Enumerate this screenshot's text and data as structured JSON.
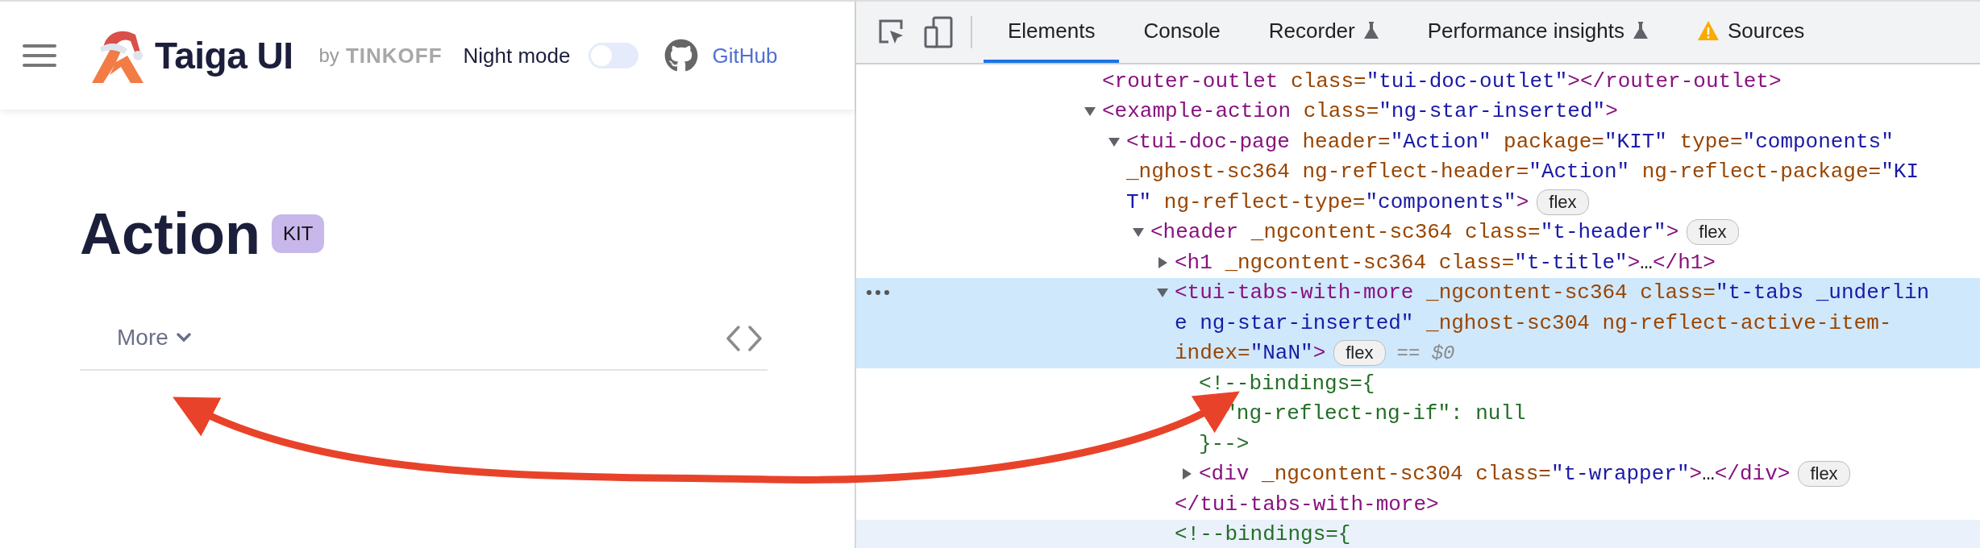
{
  "site_header": {
    "brand": "Taiga UI",
    "by": "by",
    "company": "TINKOFF",
    "night_mode": {
      "label": "Night mode",
      "on": false
    },
    "github": "GitHub"
  },
  "page": {
    "title": "Action",
    "badge": "KIT",
    "tabs": [
      {
        "label": "More",
        "selected": false
      }
    ]
  },
  "devtools": {
    "tabs": [
      {
        "label": "Elements",
        "selected": true,
        "kind": "plain"
      },
      {
        "label": "Console",
        "selected": false,
        "kind": "plain"
      },
      {
        "label": "Recorder",
        "selected": false,
        "kind": "beta"
      },
      {
        "label": "Performance insights",
        "selected": false,
        "kind": "beta"
      },
      {
        "label": "Sources",
        "selected": false,
        "kind": "warning"
      }
    ],
    "tree": [
      {
        "selected": false,
        "hovered": false,
        "lines": [
          {
            "code": [
              {
                "kind": "tag",
                "text": "<router-outlet"
              },
              {
                "kind": "attr",
                "text": " class="
              },
              {
                "kind": "value",
                "text": "\"tui-doc-outlet\""
              },
              {
                "kind": "tag",
                "text": "></router-outlet>"
              }
            ]
          }
        ]
      },
      {
        "expanded": true,
        "selected": false,
        "hovered": false,
        "lines": [
          {
            "code": [
              {
                "kind": "tag",
                "text": "<example-action"
              },
              {
                "kind": "attr",
                "text": " class="
              },
              {
                "kind": "value",
                "text": "\"ng-star-inserted\""
              },
              {
                "kind": "tag",
                "text": ">"
              }
            ]
          }
        ],
        "children": [
          {
            "expanded": true,
            "selected": false,
            "hovered": false,
            "lines": [
              {
                "code": [
                  {
                    "kind": "tag",
                    "text": "<tui-doc-page"
                  },
                  {
                    "kind": "attr",
                    "text": " header="
                  },
                  {
                    "kind": "value",
                    "text": "\"Action\""
                  },
                  {
                    "kind": "attr",
                    "text": " package="
                  },
                  {
                    "kind": "value",
                    "text": "\"KIT\""
                  },
                  {
                    "kind": "attr",
                    "text": " type="
                  },
                  {
                    "kind": "value",
                    "text": "\"components\""
                  }
                ]
              },
              {
                "code": [
                  {
                    "kind": "attr",
                    "text": "_nghost-sc364 ng-reflect-header="
                  },
                  {
                    "kind": "value",
                    "text": "\"Action\""
                  },
                  {
                    "kind": "attr",
                    "text": " ng-reflect-package="
                  },
                  {
                    "kind": "value",
                    "text": "\"KI"
                  }
                ]
              },
              {
                "code": [
                  {
                    "kind": "value",
                    "text": "T\""
                  },
                  {
                    "kind": "attr",
                    "text": " ng-reflect-type="
                  },
                  {
                    "kind": "value",
                    "text": "\"components\""
                  },
                  {
                    "kind": "tag",
                    "text": ">"
                  }
                ],
                "badge": "flex"
              }
            ],
            "children": [
              {
                "expanded": true,
                "selected": false,
                "hovered": false,
                "lines": [
                  {
                    "code": [
                      {
                        "kind": "tag",
                        "text": "<header"
                      },
                      {
                        "kind": "attr",
                        "text": " _ngcontent-sc364 class="
                      },
                      {
                        "kind": "value",
                        "text": "\"t-header\""
                      },
                      {
                        "kind": "tag",
                        "text": ">"
                      }
                    ],
                    "badge": "flex"
                  }
                ],
                "children": [
                  {
                    "expanded": false,
                    "selected": false,
                    "hovered": false,
                    "lines": [
                      {
                        "code": [
                          {
                            "kind": "tag",
                            "text": "<h1"
                          },
                          {
                            "kind": "attr",
                            "text": " _ngcontent-sc364 class="
                          },
                          {
                            "kind": "value",
                            "text": "\"t-title\""
                          },
                          {
                            "kind": "tag",
                            "text": ">"
                          },
                          {
                            "kind": "plain",
                            "text": "…"
                          },
                          {
                            "kind": "tag",
                            "text": "</h1>"
                          }
                        ]
                      }
                    ]
                  },
                  {
                    "expanded": true,
                    "selected": true,
                    "hovered": false,
                    "lines": [
                      {
                        "code": [
                          {
                            "kind": "tag",
                            "text": "<tui-tabs-with-more"
                          },
                          {
                            "kind": "attr",
                            "text": " _ngcontent-sc364 class="
                          },
                          {
                            "kind": "value",
                            "text": "\"t-tabs _underlin"
                          }
                        ]
                      },
                      {
                        "code": [
                          {
                            "kind": "value",
                            "text": "e ng-star-inserted\""
                          },
                          {
                            "kind": "attr",
                            "text": " _nghost-sc304 ng-reflect-active-item-"
                          }
                        ]
                      },
                      {
                        "code": [
                          {
                            "kind": "attr",
                            "text": "index="
                          },
                          {
                            "kind": "value",
                            "text": "\"NaN\""
                          },
                          {
                            "kind": "tag",
                            "text": ">"
                          }
                        ],
                        "badge": "flex",
                        "ref": "== $0"
                      }
                    ],
                    "closing": [
                      {
                        "kind": "tag",
                        "text": "</tui-tabs-with-more>"
                      }
                    ],
                    "children": [
                      {
                        "selected": false,
                        "hovered": false,
                        "lines": [
                          {
                            "code": [
                              {
                                "kind": "comment",
                                "text": "<!--bindings={"
                              }
                            ]
                          },
                          {
                            "code": [
                              {
                                "kind": "comment",
                                "text": "  \"ng-reflect-ng-if\": null"
                              }
                            ]
                          },
                          {
                            "code": [
                              {
                                "kind": "comment",
                                "text": "}-->"
                              }
                            ]
                          }
                        ]
                      },
                      {
                        "expanded": false,
                        "selected": false,
                        "hovered": false,
                        "lines": [
                          {
                            "code": [
                              {
                                "kind": "tag",
                                "text": "<div"
                              },
                              {
                                "kind": "attr",
                                "text": " _ngcontent-sc304 class="
                              },
                              {
                                "kind": "value",
                                "text": "\"t-wrapper\""
                              },
                              {
                                "kind": "tag",
                                "text": ">"
                              },
                              {
                                "kind": "plain",
                                "text": "…"
                              },
                              {
                                "kind": "tag",
                                "text": "</div>"
                              }
                            ],
                            "badge": "flex"
                          }
                        ]
                      }
                    ]
                  },
                  {
                    "selected": false,
                    "hovered": true,
                    "lines": [
                      {
                        "code": [
                          {
                            "kind": "comment",
                            "text": "<!--bindings={"
                          }
                        ]
                      }
                    ]
                  }
                ]
              }
            ]
          }
        ]
      }
    ]
  }
}
